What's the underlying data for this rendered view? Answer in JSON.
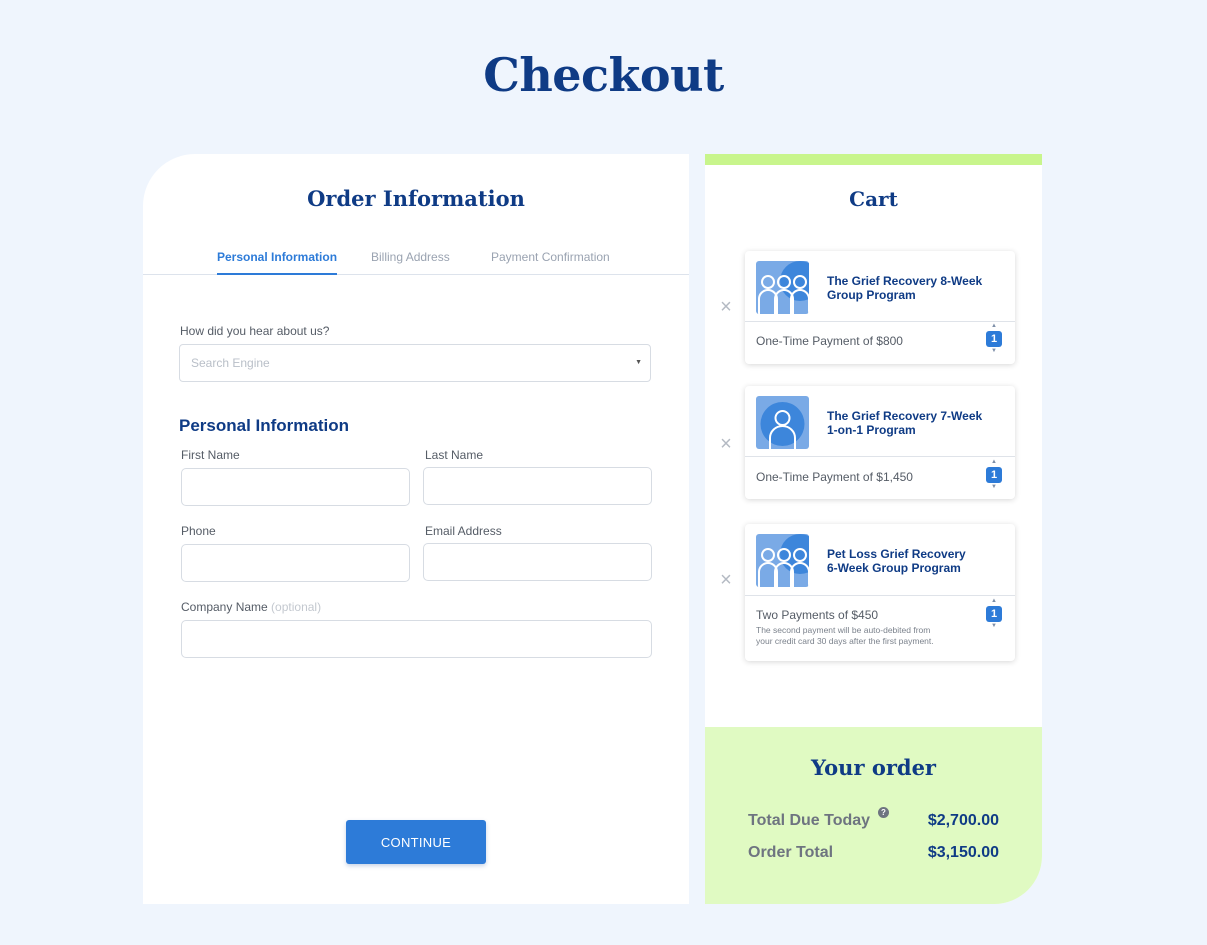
{
  "page": {
    "title": "Checkout"
  },
  "order": {
    "title": "Order Information",
    "tabs": [
      {
        "label": "Personal Information",
        "active": true
      },
      {
        "label": "Billing Address",
        "active": false
      },
      {
        "label": "Payment Confirmation",
        "active": false
      }
    ],
    "referral": {
      "label": "How did you hear about us?",
      "value": "Search Engine"
    },
    "section_heading": "Personal Information",
    "fields": {
      "first_name": {
        "label": "First Name",
        "value": ""
      },
      "last_name": {
        "label": "Last Name",
        "value": ""
      },
      "phone": {
        "label": "Phone",
        "value": ""
      },
      "email": {
        "label": "Email Address",
        "value": ""
      },
      "company": {
        "label": "Company Name",
        "optional": "(optional)",
        "value": ""
      }
    },
    "continue_label": "CONTINUE"
  },
  "cart": {
    "title": "Cart",
    "items": [
      {
        "name_line1": "The Grief Recovery 8-Week",
        "name_line2": "Group Program",
        "payment": "One-Time Payment of $800",
        "note_line1": "",
        "note_line2": "",
        "quantity": "1",
        "icon": "group-icon"
      },
      {
        "name_line1": "The Grief Recovery 7-Week",
        "name_line2": "1-on-1 Program",
        "payment": "One-Time Payment of $1,450",
        "note_line1": "",
        "note_line2": "",
        "quantity": "1",
        "icon": "person-icon"
      },
      {
        "name_line1": "Pet Loss Grief Recovery",
        "name_line2": "6-Week Group Program",
        "payment": "Two Payments of $450",
        "note_line1": "The second payment will be auto-debited from",
        "note_line2": "your credit card 30 days after the first payment.",
        "quantity": "1",
        "icon": "group-icon"
      }
    ],
    "remove_glyph": "×",
    "up_glyph": "▲",
    "down_glyph": "▼"
  },
  "summary": {
    "title": "Your order",
    "total_due_label": "Total Due Today",
    "total_due_help": "?",
    "total_due_value": "$2,700.00",
    "order_total_label": "Order Total",
    "order_total_value": "$3,150.00"
  },
  "colors": {
    "background": "#eff5fd",
    "brand_navy": "#0f3b85",
    "accent_blue": "#2d7bd8",
    "cart_accent": "#c8f58c",
    "summary_bg": "#e0fac2"
  }
}
